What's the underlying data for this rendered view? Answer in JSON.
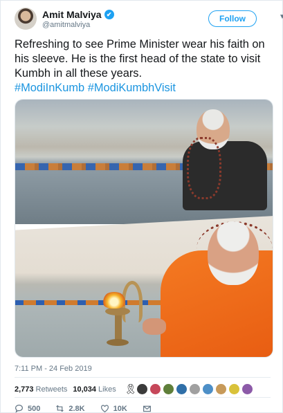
{
  "author": {
    "name": "Amit Malviya",
    "handle": "@amitmalviya",
    "verified_badge": "✔",
    "follow_label": "Follow"
  },
  "tweet": {
    "text": "Refreshing to see Prime Minister wear his faith on his sleeve. He is the first head of the state to visit Kumbh in all these years.",
    "hashtags": [
      "#ModiInKumb",
      "#ModiKumbhVisit"
    ]
  },
  "meta": {
    "timestamp": "7:11 PM - 24 Feb 2019"
  },
  "stats": {
    "retweets_count": "2,773",
    "retweets_label": "Retweets",
    "likes_count": "10,034",
    "likes_label": "Likes",
    "liker_colors": [
      "#3b3b3b",
      "#c6475a",
      "#5f7f3a",
      "#2f6fa8",
      "#a0a0a0",
      "#4d8fc7",
      "#c79a5a",
      "#d9c23a",
      "#8c5aa8"
    ]
  },
  "actions": {
    "reply_count": "500",
    "retweet_count": "2.8K",
    "like_count": "10K"
  },
  "colors": {
    "accent": "#1da1f2",
    "hashtag": "#1b95e0",
    "muted": "#657786"
  }
}
